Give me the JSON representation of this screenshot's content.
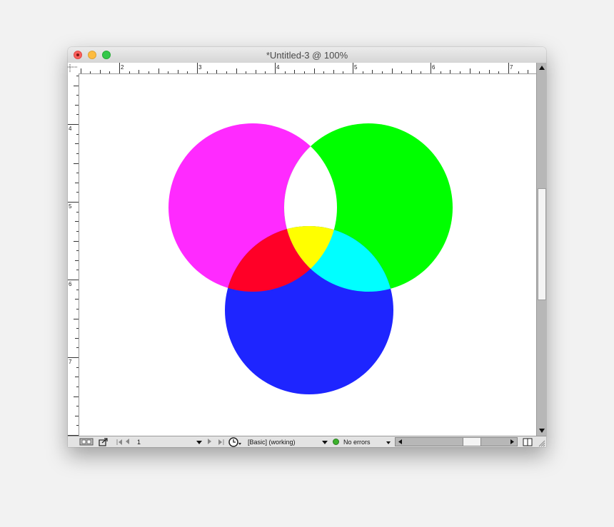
{
  "window": {
    "title": "*Untitled-3 @ 100%"
  },
  "rulers": {
    "horizontal_labels": [
      "2",
      "3",
      "4",
      "5",
      "6",
      "7"
    ],
    "vertical_labels": [
      "4",
      "5",
      "6",
      "7"
    ]
  },
  "canvas": {
    "circles": [
      {
        "name": "magenta",
        "color": "#ff2aff"
      },
      {
        "name": "green",
        "color": "#00ff00"
      },
      {
        "name": "blue",
        "color": "#1e25ff"
      }
    ],
    "overlaps": {
      "magenta_green": "#ffffff",
      "magenta_blue": "#ff0027",
      "green_blue": "#00ffff",
      "all": "#ffff00"
    }
  },
  "statusbar": {
    "page_number": "1",
    "style_label": "[Basic] (working)",
    "errors_label": "No errors"
  }
}
